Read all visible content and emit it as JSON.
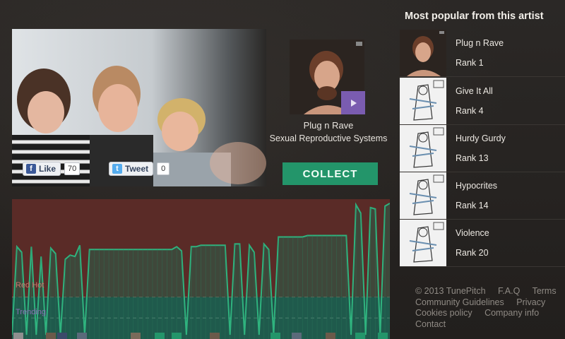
{
  "social": {
    "like_label": "Like",
    "like_count": "70",
    "tweet_label": "Tweet",
    "tweet_count": "0",
    "fb_icon": "f",
    "tw_icon": "t"
  },
  "track": {
    "title": "Plug n Rave",
    "artist": "Sexual Reproductive Systems",
    "collect_label": "COLLECT"
  },
  "chart": {
    "zone_red_label": "Red Hot",
    "zone_trending_label": "Trending"
  },
  "chart_data": {
    "type": "area",
    "title": "",
    "xlabel": "",
    "ylabel": "",
    "ylim": [
      0,
      100
    ],
    "x": [
      0,
      1,
      2,
      3,
      4,
      5,
      6,
      7,
      8,
      9,
      10,
      11,
      12,
      13,
      14,
      15,
      16,
      17,
      18,
      19,
      20,
      21,
      22,
      23,
      24,
      25,
      26,
      27,
      28,
      29,
      30,
      31,
      32,
      33,
      34,
      35,
      36,
      37,
      38,
      39,
      40,
      41,
      42,
      43,
      44,
      45,
      46,
      47,
      48,
      49,
      50,
      51,
      52,
      53,
      54,
      55,
      56,
      57,
      58,
      59,
      60,
      61,
      62,
      63,
      64,
      65,
      66,
      67,
      68,
      69,
      70,
      71,
      72,
      73,
      74,
      75,
      76,
      77,
      78
    ],
    "values": [
      3,
      66,
      62,
      3,
      66,
      3,
      59,
      3,
      65,
      61,
      3,
      57,
      60,
      59,
      67,
      3,
      64,
      64,
      64,
      64,
      64,
      64,
      64,
      64,
      64,
      64,
      64,
      64,
      64,
      64,
      64,
      64,
      64,
      64,
      66,
      63,
      3,
      66,
      66,
      67,
      67,
      67,
      67,
      67,
      67,
      3,
      68,
      68,
      3,
      67,
      62,
      3,
      68,
      64,
      3,
      73,
      73,
      73,
      73,
      73,
      73,
      74,
      74,
      74,
      74,
      74,
      74,
      74,
      74,
      74,
      3,
      96,
      90,
      3,
      94,
      93,
      3,
      95,
      97
    ],
    "thresholds": [
      {
        "name": "Red Hot",
        "value": 30
      },
      {
        "name": "Trending",
        "value": 15
      }
    ],
    "grid": false,
    "legend": "none"
  },
  "sidebar": {
    "title": "Most popular from this artist",
    "items": [
      {
        "name": "Plug n Rave",
        "rank": "Rank 1",
        "art": "portrait"
      },
      {
        "name": "Give It All",
        "rank": "Rank 4",
        "art": "sketch"
      },
      {
        "name": "Hurdy Gurdy",
        "rank": "Rank 13",
        "art": "sketch"
      },
      {
        "name": "Hypocrites",
        "rank": "Rank 14",
        "art": "sketch"
      },
      {
        "name": "Violence",
        "rank": "Rank 20",
        "art": "sketch"
      }
    ]
  },
  "footer": {
    "copyright": "© 2013 TunePitch",
    "faq": "F.A.Q",
    "terms": "Terms",
    "community": "Community Guidelines",
    "privacy": "Privacy",
    "cookies": "Cookies policy",
    "company": "Company info",
    "contact": "Contact"
  },
  "colors": {
    "background": "#262422",
    "collect_green": "#23956a",
    "play_purple": "#7a5cb0",
    "red_zone": "#5a2b27",
    "trend_zone": "#1f4e47",
    "line": "#2fb37e"
  }
}
